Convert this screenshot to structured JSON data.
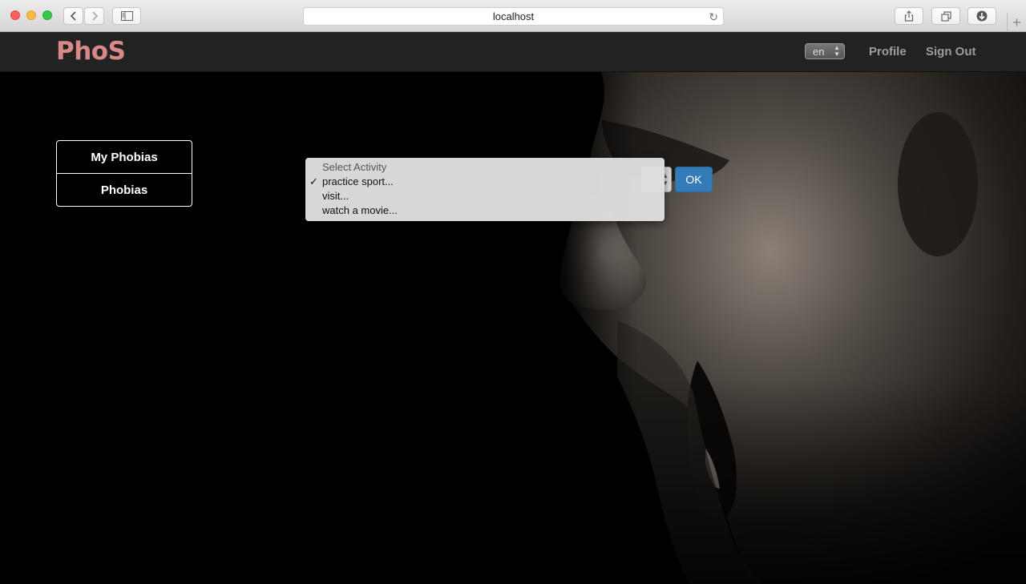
{
  "browser": {
    "url": "localhost",
    "icons": {
      "back": "chevron-left-icon",
      "forward": "chevron-right-icon",
      "sidebar": "sidebar-icon",
      "reload": "reload-icon",
      "share": "share-icon",
      "tabs": "tabs-icon",
      "downloads": "download-icon",
      "new_tab": "plus-icon"
    }
  },
  "navbar": {
    "brand": "PhoS",
    "language": "en",
    "links": [
      "Profile",
      "Sign Out"
    ]
  },
  "sidebar": {
    "items": [
      "My Phobias",
      "Phobias"
    ]
  },
  "activity_select": {
    "options": [
      "Select Activity",
      "practice sport...",
      "visit...",
      "watch a movie..."
    ],
    "selected": "practice sport...",
    "check_glyph": "✓"
  },
  "ok_button": "OK",
  "colors": {
    "brand": "#d9888a",
    "navbar_bg": "#222222",
    "navlink": "#9d9d9d",
    "primary_button": "#337ab7",
    "page_bg": "#000000"
  }
}
